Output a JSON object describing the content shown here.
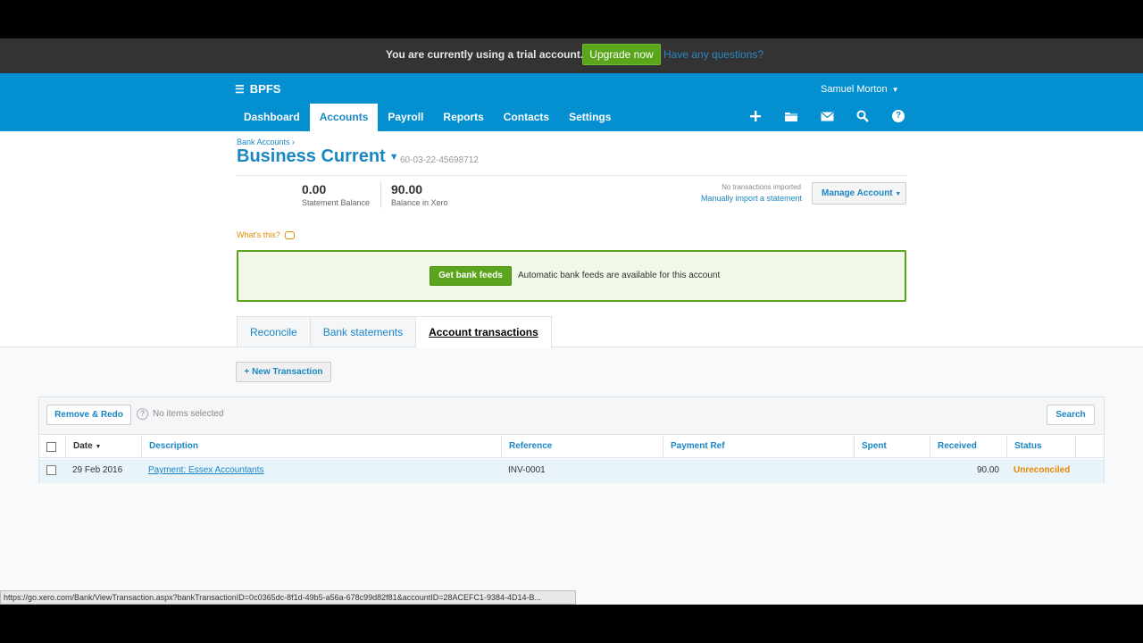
{
  "trial": {
    "message": "You are currently using a trial account.",
    "upgrade_label": "Upgrade now",
    "questions_label": "Have any questions?"
  },
  "header": {
    "org_name": "BPFS",
    "user_name": "Samuel Morton",
    "nav": [
      {
        "label": "Dashboard"
      },
      {
        "label": "Accounts",
        "active": true
      },
      {
        "label": "Payroll"
      },
      {
        "label": "Reports"
      },
      {
        "label": "Contacts"
      },
      {
        "label": "Settings"
      }
    ],
    "tools": [
      "plus-icon",
      "folder-icon",
      "mail-icon",
      "search-icon",
      "help-icon"
    ],
    "brand_color": "#048fd0"
  },
  "account": {
    "breadcrumb": "Bank Accounts ›",
    "title": "Business Current",
    "number": "60-03-22-45698712",
    "statement_balance": "0.00",
    "statement_balance_label": "Statement Balance",
    "xero_balance": "90.00",
    "xero_balance_label": "Balance in Xero",
    "no_transactions": "No transactions imported",
    "manual_import": "Manually import a statement",
    "manage_label": "Manage Account"
  },
  "whats_this": "What's this?",
  "feeds": {
    "button_label": "Get bank feeds",
    "message": "Automatic bank feeds are available for this account"
  },
  "tabs": [
    {
      "label": "Reconcile"
    },
    {
      "label": "Bank statements"
    },
    {
      "label": "Account transactions",
      "active": true
    }
  ],
  "new_transaction_label": "+ New Transaction",
  "toolbar": {
    "remove_label": "Remove & Redo",
    "help_glyph": "?",
    "selection_text": "No items selected",
    "search_label": "Search"
  },
  "table": {
    "columns": [
      "Date",
      "Description",
      "Reference",
      "Payment Ref",
      "Spent",
      "Received",
      "Status"
    ],
    "rows": [
      {
        "date": "29 Feb 2016",
        "description": "Payment: Essex Accountants",
        "reference": "INV-0001",
        "payment_ref": "",
        "spent": "",
        "received": "90.00",
        "status": "Unreconciled"
      }
    ]
  },
  "status_url": "https://go.xero.com/Bank/ViewTransaction.aspx?bankTransactionID=0c0365dc-8f1d-49b5-a56a-678c99d82f81&accountID=28ACEFC1-9384-4D14-B..."
}
